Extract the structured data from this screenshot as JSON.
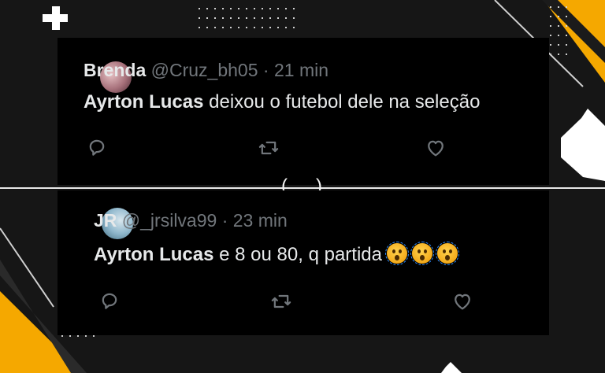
{
  "tweets": [
    {
      "name": "Brenda",
      "handle": "@Cruz_bh05",
      "separator": "·",
      "time": "21 min",
      "mention": "Ayrton Lucas",
      "text": " deixou o futebol dele na seleção",
      "emojis": []
    },
    {
      "name": "JR",
      "handle": "@_jrsilva99",
      "separator": "·",
      "time": "23 min",
      "mention": "Ayrton Lucas",
      "text": " e 8 ou 80, q partida",
      "emojis": [
        "astonished-face",
        "astonished-face",
        "astonished-face"
      ]
    }
  ],
  "overlay": {
    "left_paren": "(",
    "right_paren": ")"
  },
  "colors": {
    "background": "#000000",
    "name": "#e7e9ea",
    "muted": "#71767b",
    "accent": "#f5a800"
  },
  "icons": [
    "reply-icon",
    "retweet-icon",
    "like-icon"
  ]
}
